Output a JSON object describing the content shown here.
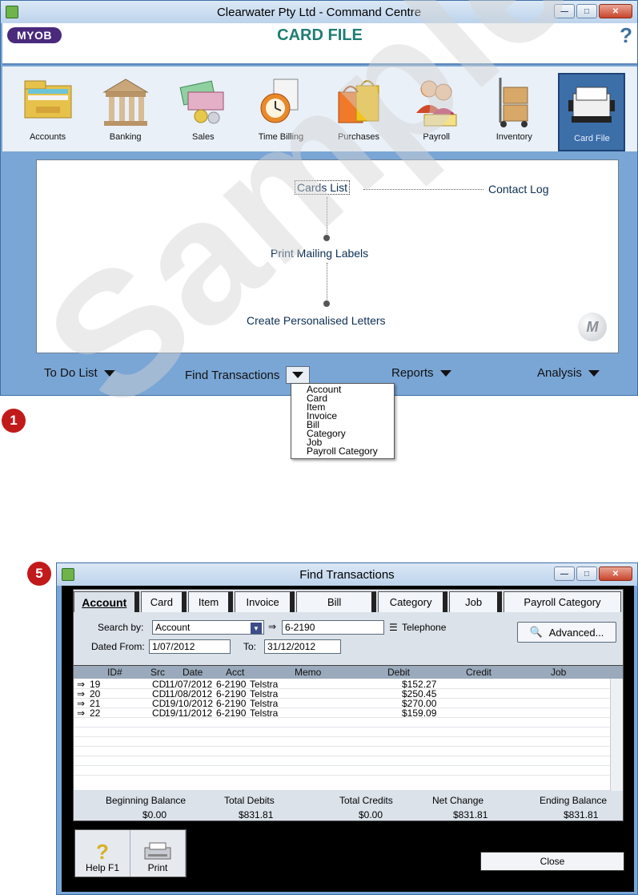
{
  "command_centre": {
    "title": "Clearwater Pty Ltd - Command Centre",
    "logo": "MYOB",
    "module_title": "CARD FILE",
    "help_glyph": "?",
    "modules": [
      {
        "label": "Accounts"
      },
      {
        "label": "Banking"
      },
      {
        "label": "Sales"
      },
      {
        "label": "Time Billing"
      },
      {
        "label": "Purchases"
      },
      {
        "label": "Payroll"
      },
      {
        "label": "Inventory"
      },
      {
        "label": "Card File"
      }
    ],
    "active_module": "Card File",
    "flow": {
      "cards_list": "Cards List",
      "contact_log": "Contact Log",
      "print_mailing_labels": "Print Mailing Labels",
      "create_personalised_letters": "Create Personalised Letters",
      "watermark_letter": "M"
    },
    "bottom_bar": {
      "todo": "To Do List",
      "find_transactions": "Find Transactions",
      "reports": "Reports",
      "analysis": "Analysis"
    },
    "find_menu": [
      "Account",
      "Card",
      "Item",
      "Invoice",
      "Bill",
      "Category",
      "Job",
      "Payroll Category"
    ]
  },
  "callouts": {
    "first": "1",
    "second": "5"
  },
  "watermark_text": "Sample",
  "find_transactions": {
    "title": "Find Transactions",
    "tabs": [
      "Account",
      "Card",
      "Item",
      "Invoice",
      "Bill",
      "Category",
      "Job",
      "Payroll Category"
    ],
    "active_tab": "Account",
    "search_by_label": "Search by:",
    "search_by_value": "Account",
    "account_value": "6-2190",
    "account_name": "Telephone",
    "dated_from_label": "Dated From:",
    "dated_from_value": "1/07/2012",
    "to_label": "To:",
    "to_value": "31/12/2012",
    "advanced_label": "Advanced...",
    "columns": [
      "ID#",
      "Src",
      "Date",
      "Acct",
      "Memo",
      "Debit",
      "Credit",
      "Job"
    ],
    "rows": [
      {
        "id": "19",
        "src": "CD",
        "date": "11/07/2012",
        "acct": "6-2190",
        "memo": "Telstra",
        "debit": "$152.27",
        "credit": "",
        "job": ""
      },
      {
        "id": "20",
        "src": "CD",
        "date": "11/08/2012",
        "acct": "6-2190",
        "memo": "Telstra",
        "debit": "$250.45",
        "credit": "",
        "job": ""
      },
      {
        "id": "21",
        "src": "CD",
        "date": "19/10/2012",
        "acct": "6-2190",
        "memo": "Telstra",
        "debit": "$270.00",
        "credit": "",
        "job": ""
      },
      {
        "id": "22",
        "src": "CD",
        "date": "19/11/2012",
        "acct": "6-2190",
        "memo": "Telstra",
        "debit": "$159.09",
        "credit": "",
        "job": ""
      }
    ],
    "totals_labels": [
      "Beginning Balance",
      "Total Debits",
      "Total Credits",
      "Net Change",
      "Ending Balance"
    ],
    "totals_values": [
      "$0.00",
      "$831.81",
      "$0.00",
      "$831.81",
      "$831.81"
    ],
    "help_label": "Help F1",
    "print_label": "Print",
    "close_label": "Close"
  },
  "colors": {
    "window_frame": "#7aa6d6",
    "module_title": "#1f7d74",
    "callout": "#c11a1a",
    "active_module": "#3c6ea8"
  }
}
